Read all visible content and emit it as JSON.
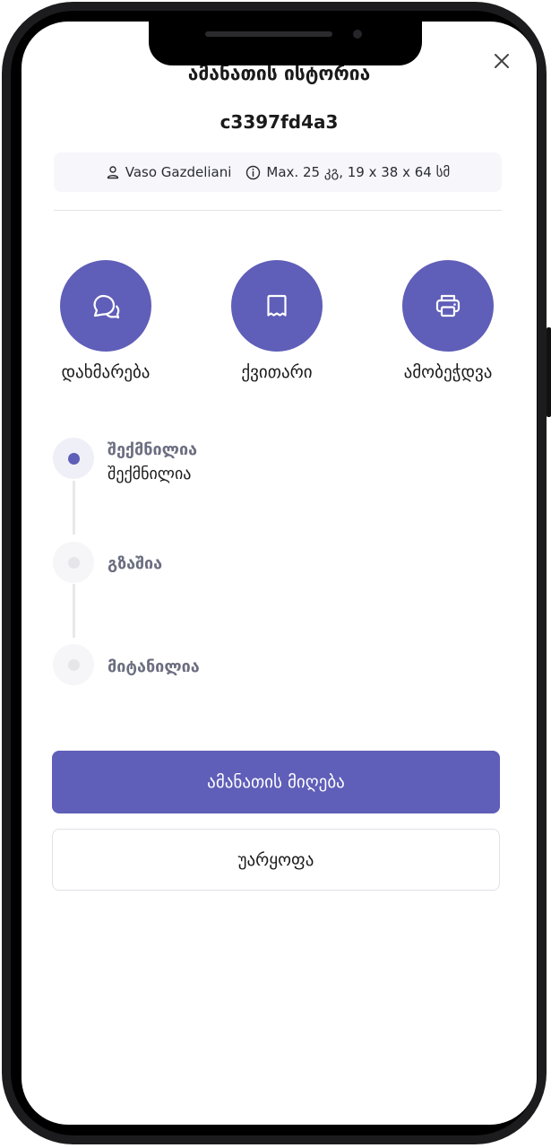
{
  "header": {
    "title": "ამანათის ისტორია",
    "parcel_code": "c3397fd4a3"
  },
  "info": {
    "user_icon": "user-icon",
    "recipient": "Vaso Gazdeliani",
    "info_icon": "info-icon",
    "limits": "Max. 25 კგ, 19 x 38 x 64 სმ"
  },
  "actions": [
    {
      "label": "დახმარება",
      "icon": "chat-bubbles-icon"
    },
    {
      "label": "ქვითარი",
      "icon": "receipt-icon"
    },
    {
      "label": "ამობეჭდვა",
      "icon": "printer-icon"
    }
  ],
  "timeline": [
    {
      "title": "შექმნილია",
      "subtitle": "შექმნილია",
      "active": true
    },
    {
      "title": "გზაშია",
      "active": false
    },
    {
      "title": "მიტანილია",
      "active": false
    }
  ],
  "buttons": {
    "accept": "ამანათის მიღება",
    "reject": "უარყოფა"
  },
  "colors": {
    "accent": "#5f5eb8",
    "active_dot_bg": "#efeff8",
    "inactive_dot_bg": "#f6f6f8",
    "inactive_dot": "#e6e6ea"
  }
}
